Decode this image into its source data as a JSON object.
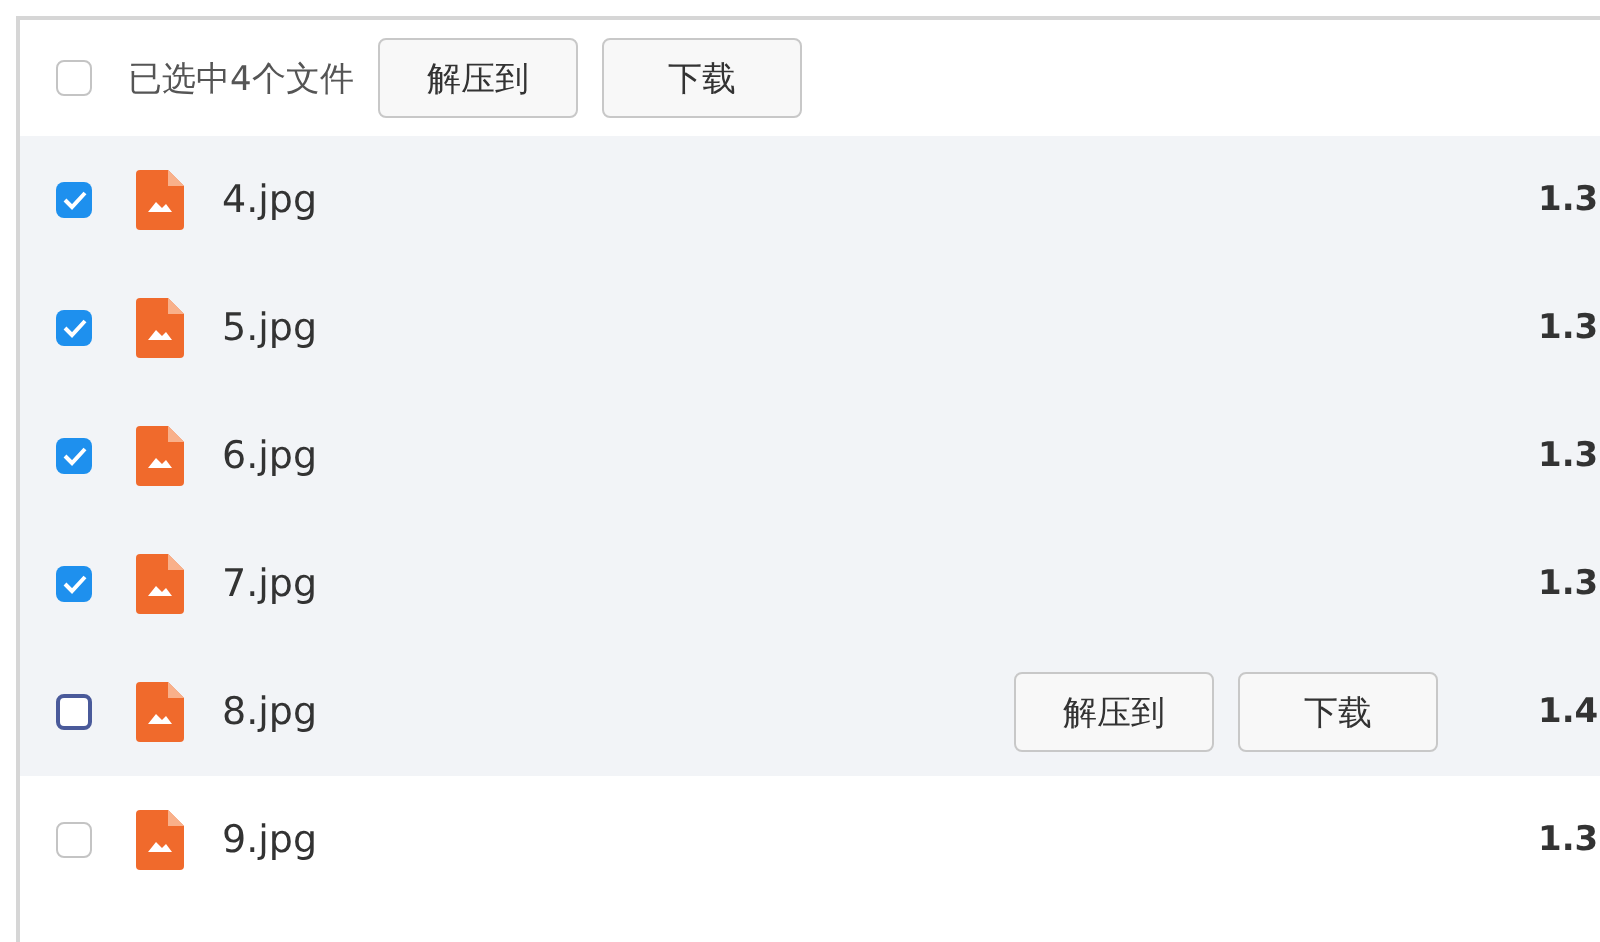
{
  "header": {
    "checked": false,
    "summary": "已选中4个文件",
    "buttons": [
      "解压到",
      "下载"
    ]
  },
  "rows": [
    {
      "name": "4.jpg",
      "size": "1.3",
      "checked": true,
      "hovered": false
    },
    {
      "name": "5.jpg",
      "size": "1.3",
      "checked": true,
      "hovered": false
    },
    {
      "name": "6.jpg",
      "size": "1.3",
      "checked": true,
      "hovered": false
    },
    {
      "name": "7.jpg",
      "size": "1.3",
      "checked": true,
      "hovered": false
    },
    {
      "name": "8.jpg",
      "size": "1.4",
      "checked": false,
      "hovered": true,
      "actions": [
        "解压到",
        "下载"
      ]
    },
    {
      "name": "9.jpg",
      "size": "1.3",
      "checked": false,
      "hovered": false
    }
  ]
}
